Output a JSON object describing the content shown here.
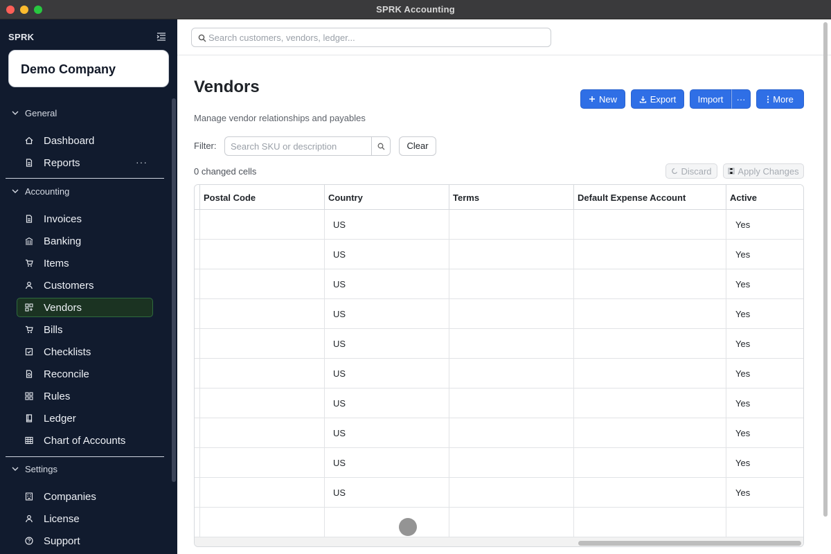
{
  "window": {
    "title": "SPRK Accounting"
  },
  "sidebar": {
    "brand": "SPRK",
    "company": "Demo Company",
    "sections": {
      "general": {
        "label": "General"
      },
      "accounting": {
        "label": "Accounting"
      },
      "settings": {
        "label": "Settings"
      }
    },
    "general_items": [
      {
        "label": "Dashboard",
        "icon": "home-icon"
      },
      {
        "label": "Reports",
        "icon": "document-icon",
        "more": "···"
      }
    ],
    "accounting_items": [
      {
        "label": "Invoices",
        "icon": "document-icon"
      },
      {
        "label": "Banking",
        "icon": "bank-icon"
      },
      {
        "label": "Items",
        "icon": "cart-icon"
      },
      {
        "label": "Customers",
        "icon": "user-icon"
      },
      {
        "label": "Vendors",
        "icon": "vendor-icon",
        "active": true
      },
      {
        "label": "Bills",
        "icon": "cart-icon"
      },
      {
        "label": "Checklists",
        "icon": "checklist-icon"
      },
      {
        "label": "Reconcile",
        "icon": "reconcile-icon"
      },
      {
        "label": "Rules",
        "icon": "grid-icon"
      },
      {
        "label": "Ledger",
        "icon": "book-icon"
      },
      {
        "label": "Chart of Accounts",
        "icon": "table-icon"
      }
    ],
    "settings_items": [
      {
        "label": "Companies",
        "icon": "building-icon"
      },
      {
        "label": "License",
        "icon": "user-icon"
      },
      {
        "label": "Support",
        "icon": "help-icon"
      }
    ]
  },
  "topbar": {
    "search_placeholder": "Search customers, vendors, ledger..."
  },
  "page": {
    "title": "Vendors",
    "subtitle": "Manage vendor relationships and payables",
    "buttons": {
      "new": "New",
      "export": "Export",
      "import": "Import",
      "import_more": "···",
      "more": "More"
    },
    "filter": {
      "label": "Filter:",
      "placeholder": "Search SKU or description",
      "clear": "Clear"
    },
    "changed_cells": "0 changed cells",
    "discard": "Discard",
    "apply": "Apply Changes"
  },
  "table": {
    "columns": [
      "Postal Code",
      "Country",
      "Terms",
      "Default Expense Account",
      "Active"
    ],
    "rows": [
      [
        "",
        "US",
        "",
        "",
        "Yes"
      ],
      [
        "",
        "US",
        "",
        "",
        "Yes"
      ],
      [
        "",
        "US",
        "",
        "",
        "Yes"
      ],
      [
        "",
        "US",
        "",
        "",
        "Yes"
      ],
      [
        "",
        "US",
        "",
        "",
        "Yes"
      ],
      [
        "",
        "US",
        "",
        "",
        "Yes"
      ],
      [
        "",
        "US",
        "",
        "",
        "Yes"
      ],
      [
        "",
        "US",
        "",
        "",
        "Yes"
      ],
      [
        "",
        "US",
        "",
        "",
        "Yes"
      ],
      [
        "",
        "US",
        "",
        "",
        "Yes"
      ],
      [
        "",
        "",
        "",
        "",
        ""
      ]
    ]
  },
  "colors": {
    "accent": "#2f6fe6",
    "sidebar_bg": "#111b2e",
    "active_nav_bg": "#1b3322"
  }
}
